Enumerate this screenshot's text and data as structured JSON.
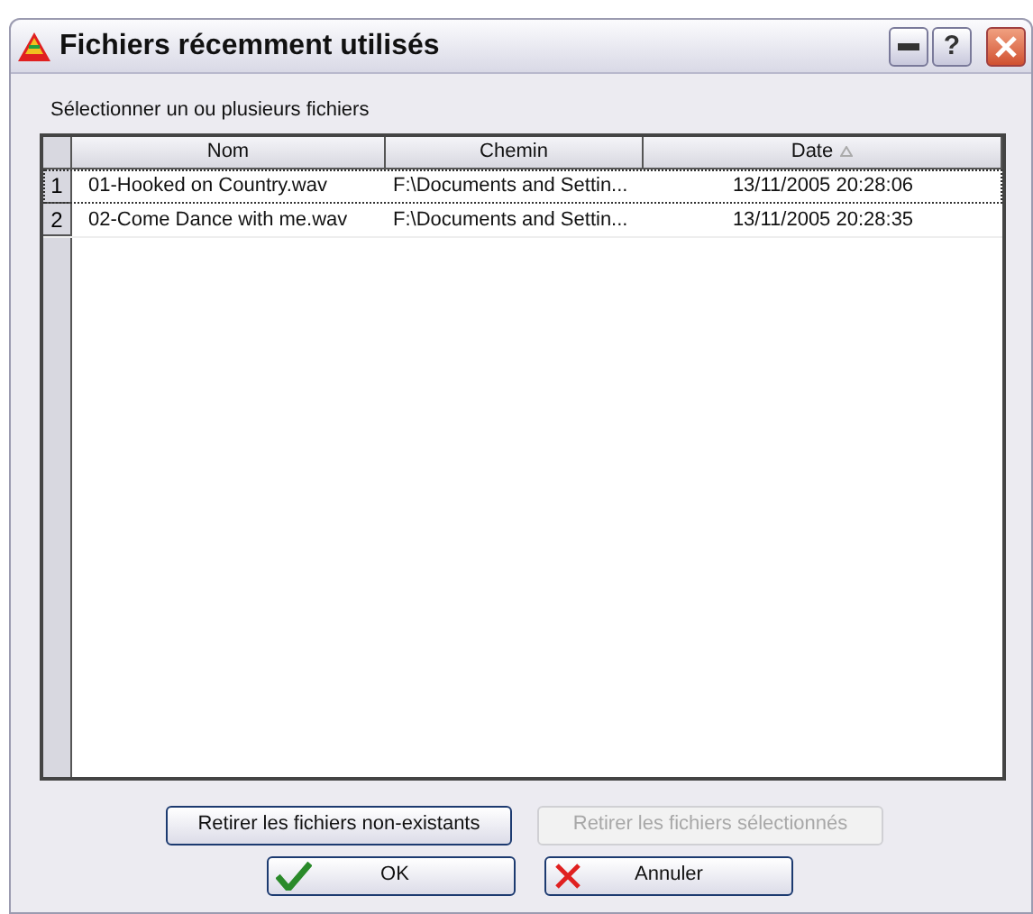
{
  "window": {
    "title": "Fichiers récemment utilisés",
    "help_button": "?"
  },
  "instruction": "Sélectionner un ou plusieurs fichiers",
  "table": {
    "columns": [
      {
        "label": "Nom",
        "sorted": false
      },
      {
        "label": "Chemin",
        "sorted": false
      },
      {
        "label": "Date",
        "sorted": true
      }
    ],
    "rows": [
      {
        "number": "1",
        "cells": [
          "01-Hooked on Country.wav",
          "F:\\Documents and Settin...",
          "13/11/2005 20:28:06"
        ],
        "focused": true
      },
      {
        "number": "2",
        "cells": [
          "02-Come Dance with me.wav",
          "F:\\Documents and Settin...",
          "13/11/2005 20:28:35"
        ],
        "focused": false
      }
    ]
  },
  "actions": [
    {
      "label": "Retirer les fichiers non-existants",
      "disabled": false
    },
    {
      "label": "Retirer les fichiers sélectionnés",
      "disabled": true
    }
  ],
  "buttons": [
    {
      "label": "OK",
      "kind": "ok"
    },
    {
      "label": "Annuler",
      "kind": "cancel"
    }
  ]
}
